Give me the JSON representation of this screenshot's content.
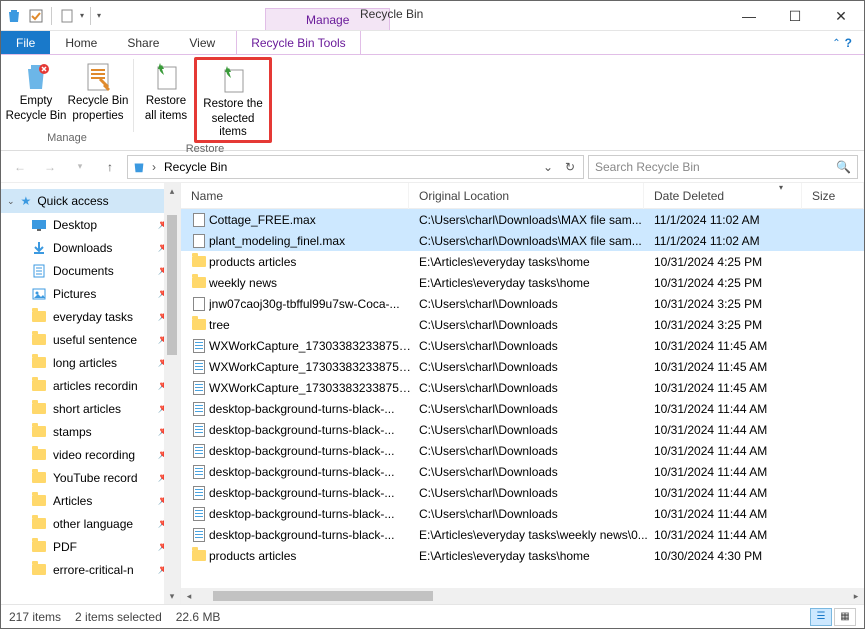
{
  "window": {
    "title": "Recycle Bin",
    "context_tab_header": "Manage",
    "context_tab_label": "Recycle Bin Tools",
    "min": "—",
    "max": "☐",
    "close": "✕"
  },
  "tabs": {
    "file": "File",
    "home": "Home",
    "share": "Share",
    "view": "View"
  },
  "ribbon": {
    "manage_group": "Manage",
    "restore_group": "Restore",
    "empty": "Empty Recycle Bin",
    "empty_l1": "Empty",
    "empty_l2": "Recycle Bin",
    "props": "Recycle Bin properties",
    "props_l1": "Recycle Bin",
    "props_l2": "properties",
    "restore_all": "Restore all items",
    "restore_all_l1": "Restore",
    "restore_all_l2": "all items",
    "restore_sel": "Restore the selected items",
    "restore_sel_l1": "Restore the",
    "restore_sel_l2": "selected items"
  },
  "nav": {
    "breadcrumb": "Recycle Bin",
    "search_placeholder": "Search Recycle Bin"
  },
  "sidebar": {
    "quick": "Quick access",
    "items": [
      {
        "label": "Desktop",
        "icon": "desktop"
      },
      {
        "label": "Downloads",
        "icon": "downloads"
      },
      {
        "label": "Documents",
        "icon": "documents"
      },
      {
        "label": "Pictures",
        "icon": "pictures"
      },
      {
        "label": "everyday tasks",
        "icon": "folder"
      },
      {
        "label": "useful sentence",
        "icon": "folder"
      },
      {
        "label": "long articles",
        "icon": "folder"
      },
      {
        "label": "articles recordin",
        "icon": "folder"
      },
      {
        "label": "short articles",
        "icon": "folder"
      },
      {
        "label": "stamps",
        "icon": "folder"
      },
      {
        "label": "video recording",
        "icon": "folder"
      },
      {
        "label": "YouTube record",
        "icon": "folder"
      },
      {
        "label": "Articles",
        "icon": "folder"
      },
      {
        "label": "other language",
        "icon": "folder"
      },
      {
        "label": "PDF",
        "icon": "folder"
      },
      {
        "label": "errore-critical-n",
        "icon": "folder"
      }
    ]
  },
  "columns": {
    "name": "Name",
    "location": "Original Location",
    "date": "Date Deleted",
    "size": "Size"
  },
  "rows": [
    {
      "sel": true,
      "icon": "doc",
      "name": "Cottage_FREE.max",
      "loc": "C:\\Users\\charl\\Downloads\\MAX file sam...",
      "date": "11/1/2024 11:02 AM"
    },
    {
      "sel": true,
      "icon": "doc",
      "name": "plant_modeling_finel.max",
      "loc": "C:\\Users\\charl\\Downloads\\MAX file sam...",
      "date": "11/1/2024 11:02 AM"
    },
    {
      "sel": false,
      "icon": "folder",
      "name": "products articles",
      "loc": "E:\\Articles\\everyday tasks\\home",
      "date": "10/31/2024 4:25 PM"
    },
    {
      "sel": false,
      "icon": "folder",
      "name": "weekly news",
      "loc": "E:\\Articles\\everyday tasks\\home",
      "date": "10/31/2024 4:25 PM"
    },
    {
      "sel": false,
      "icon": "doc",
      "name": "jnw07caoj30g-tbfful99u7sw-Coca-...",
      "loc": "C:\\Users\\charl\\Downloads",
      "date": "10/31/2024 3:25 PM"
    },
    {
      "sel": false,
      "icon": "folder",
      "name": "tree",
      "loc": "C:\\Users\\charl\\Downloads",
      "date": "10/31/2024 3:25 PM"
    },
    {
      "sel": false,
      "icon": "docb",
      "name": "WXWorkCapture_17303383233875 (...",
      "loc": "C:\\Users\\charl\\Downloads",
      "date": "10/31/2024 11:45 AM"
    },
    {
      "sel": false,
      "icon": "docb",
      "name": "WXWorkCapture_17303383233875 (...",
      "loc": "C:\\Users\\charl\\Downloads",
      "date": "10/31/2024 11:45 AM"
    },
    {
      "sel": false,
      "icon": "docb",
      "name": "WXWorkCapture_17303383233875 (...",
      "loc": "C:\\Users\\charl\\Downloads",
      "date": "10/31/2024 11:45 AM"
    },
    {
      "sel": false,
      "icon": "docb",
      "name": "desktop-background-turns-black-...",
      "loc": "C:\\Users\\charl\\Downloads",
      "date": "10/31/2024 11:44 AM"
    },
    {
      "sel": false,
      "icon": "docb",
      "name": "desktop-background-turns-black-...",
      "loc": "C:\\Users\\charl\\Downloads",
      "date": "10/31/2024 11:44 AM"
    },
    {
      "sel": false,
      "icon": "docb",
      "name": "desktop-background-turns-black-...",
      "loc": "C:\\Users\\charl\\Downloads",
      "date": "10/31/2024 11:44 AM"
    },
    {
      "sel": false,
      "icon": "docb",
      "name": "desktop-background-turns-black-...",
      "loc": "C:\\Users\\charl\\Downloads",
      "date": "10/31/2024 11:44 AM"
    },
    {
      "sel": false,
      "icon": "docb",
      "name": "desktop-background-turns-black-...",
      "loc": "C:\\Users\\charl\\Downloads",
      "date": "10/31/2024 11:44 AM"
    },
    {
      "sel": false,
      "icon": "docb",
      "name": "desktop-background-turns-black-...",
      "loc": "C:\\Users\\charl\\Downloads",
      "date": "10/31/2024 11:44 AM"
    },
    {
      "sel": false,
      "icon": "docb",
      "name": "desktop-background-turns-black-...",
      "loc": "E:\\Articles\\everyday tasks\\weekly news\\0...",
      "date": "10/31/2024 11:44 AM"
    },
    {
      "sel": false,
      "icon": "folder",
      "name": "products articles",
      "loc": "E:\\Articles\\everyday tasks\\home",
      "date": "10/30/2024 4:30 PM"
    }
  ],
  "status": {
    "count": "217 items",
    "selected": "2 items selected",
    "size": "22.6 MB"
  }
}
